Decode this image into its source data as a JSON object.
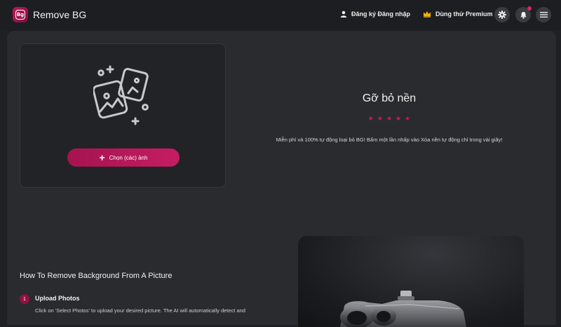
{
  "header": {
    "app_title": "Remove BG",
    "logo_text": "Bg",
    "signup_label": "Đăng ký Đăng nhập",
    "premium_label": "Dùng thử Premium",
    "icons": [
      "user-icon",
      "crown-icon",
      "gear-icon",
      "bell-icon",
      "menu-icon"
    ],
    "notification_badge": true
  },
  "upload": {
    "choose_button_label": "Chọn (các) ảnh",
    "icon": "images-icon"
  },
  "hero": {
    "title": "Gỡ bỏ nền",
    "rating_stars": 5,
    "description": "Miễn phí và 100% tự động loại bỏ BG! Bấm một lần nhấp vào Xóa nền tự động chỉ trong vài giây!"
  },
  "howto": {
    "title": "How To Remove Background From A Picture",
    "steps": [
      {
        "number": "1",
        "title": "Upload Photos",
        "description": "Click on 'Select Photos' to upload your desired picture. The AI will automatically detect and"
      }
    ]
  },
  "colors": {
    "accent": "#c51d63",
    "background": "#1f2023",
    "panel": "#2a2b2f"
  }
}
